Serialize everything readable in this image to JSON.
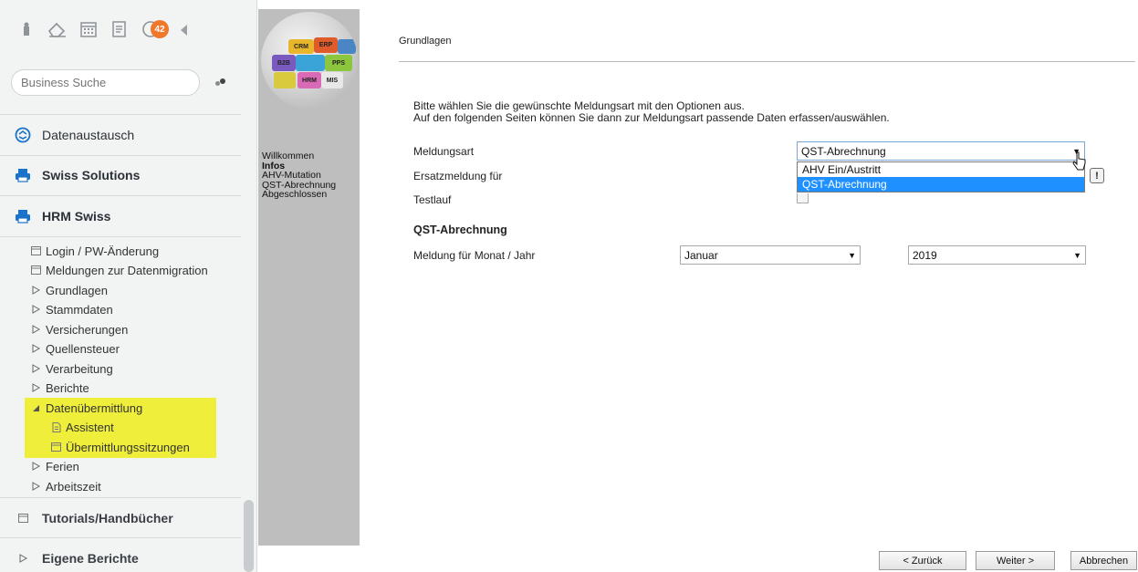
{
  "toolbar": {
    "badge_count": "42",
    "icons": [
      "user-pin-icon",
      "eraser-icon",
      "calendar-icon",
      "list-doc-icon",
      "chat-icon",
      "collapse-arrow-icon"
    ]
  },
  "search": {
    "placeholder": "Business Suche"
  },
  "sidebar": {
    "main": [
      {
        "label": "Datenaustausch",
        "icon": "exchange-icon"
      },
      {
        "label": "Swiss Solutions",
        "icon": "printer-icon"
      },
      {
        "label": "HRM Swiss",
        "icon": "printer-icon"
      }
    ],
    "sub": [
      {
        "label": "Login / PW-Änderung",
        "icon": "window-icon"
      },
      {
        "label": "Meldungen zur Datenmigration",
        "icon": "window-icon"
      },
      {
        "label": "Grundlagen",
        "icon": "triangle-right-icon"
      },
      {
        "label": "Stammdaten",
        "icon": "triangle-right-icon"
      },
      {
        "label": "Versicherungen",
        "icon": "triangle-right-icon"
      },
      {
        "label": "Quellensteuer",
        "icon": "triangle-right-icon"
      },
      {
        "label": "Verarbeitung",
        "icon": "triangle-right-icon"
      },
      {
        "label": "Berichte",
        "icon": "triangle-right-icon"
      },
      {
        "label": "Datenübermittlung",
        "icon": "triangle-down-icon"
      },
      {
        "label": "Assistent",
        "icon": "document-icon"
      },
      {
        "label": "Übermittlungssitzungen",
        "icon": "window-icon"
      },
      {
        "label": "Ferien",
        "icon": "triangle-right-icon"
      },
      {
        "label": "Arbeitszeit",
        "icon": "triangle-right-icon"
      }
    ],
    "bottom": [
      {
        "label": "Tutorials/Handbücher",
        "icon": "window-icon"
      },
      {
        "label": "Eigene Berichte",
        "icon": "triangle-right-icon"
      }
    ]
  },
  "logo": {
    "pieces": [
      "CRM",
      "ERP",
      "B2B",
      "PPS",
      "HRM",
      "MIS"
    ]
  },
  "midnav": {
    "items": [
      "Willkommen",
      "Infos",
      "AHV-Mutation",
      "QST-Abrechnung",
      "Abgeschlossen"
    ],
    "active": "Infos"
  },
  "content": {
    "breadcrumb": "Grundlagen",
    "intro_line1": "Bitte wählen Sie die gewünschte Meldungsart mit den Optionen aus.",
    "intro_line2": "Auf den folgenden Seiten können Sie dann zur Meldungsart passende Daten erfassen/auswählen.",
    "meldungsart_label": "Meldungsart",
    "meldungsart_value": "QST-Abrechnung",
    "meldungsart_options": [
      "AHV Ein/Austritt",
      "QST-Abrechnung"
    ],
    "ersatz_label": "Ersatzmeldung für",
    "testlauf_label": "Testlauf",
    "warn_glyph": "!",
    "section_heading": "QST-Abrechnung",
    "monat_label": "Meldung für Monat / Jahr",
    "month_value": "Januar",
    "year_value": "2019"
  },
  "buttons": {
    "back": "< Zurück",
    "next": "Weiter >",
    "cancel": "Abbrechen"
  },
  "colors": {
    "highlight": "#eeee3b",
    "badge": "#f0782a",
    "selected_option": "#1e90ff",
    "icon_blue": "#1a73c8"
  }
}
